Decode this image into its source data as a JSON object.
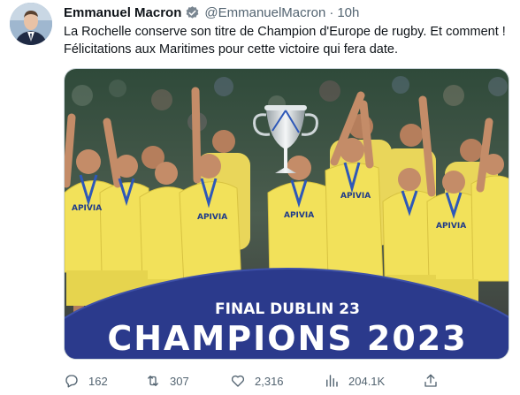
{
  "tweet": {
    "author_name": "Emmanuel Macron",
    "author_handle": "@EmmanuelMacron",
    "separator": "·",
    "time": "10h",
    "text": "La Rochelle conserve son titre de Champion d'Europe de rugby. Et comment ! Félicitations aux Maritimes pour cette victoire qui fera date."
  },
  "media": {
    "banner_subtitle": "FINAL DUBLIN 23",
    "banner_title": "CHAMPIONS 2023",
    "jersey_text": "APIVIA",
    "banner_color": "#2b3a8c",
    "jersey_color": "#f2e15a"
  },
  "actions": {
    "replies": "162",
    "retweets": "307",
    "likes": "2,316",
    "views": "204.1K"
  },
  "icons": [
    "verified-badge-icon",
    "reply-icon",
    "retweet-icon",
    "like-icon",
    "views-icon",
    "share-icon"
  ]
}
